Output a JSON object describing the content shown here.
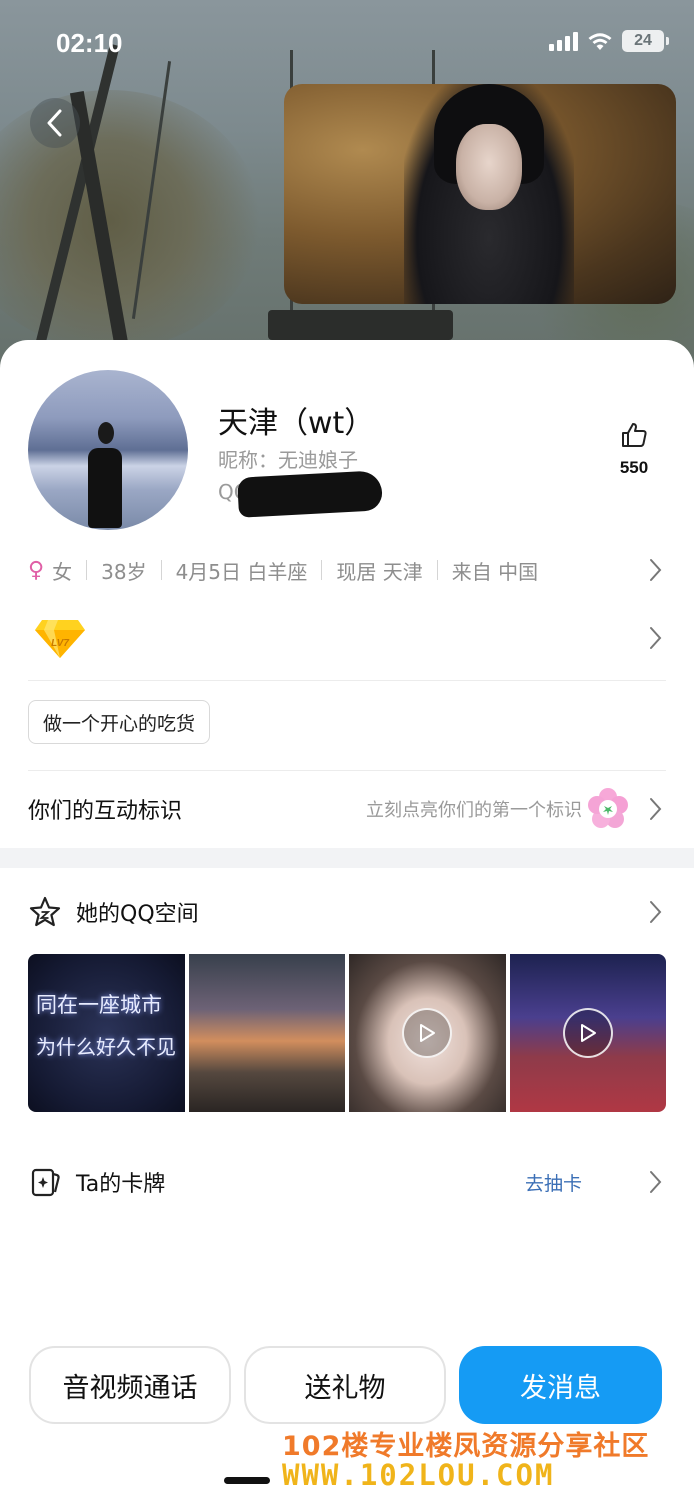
{
  "status_bar": {
    "time": "02:10",
    "battery": "24"
  },
  "profile": {
    "name": "天津（wt）",
    "nickname": "昵称：无迪娘子",
    "qq_prefix": "QQ",
    "like_count": "550"
  },
  "info": {
    "gender": "女",
    "age": "38岁",
    "birthday": "4月5日 白羊座",
    "residence": "现居 天津",
    "origin": "来自 中国"
  },
  "vip": {
    "level_badge": "LV7"
  },
  "tag": "做一个开心的吃货",
  "interaction": {
    "title": "你们的互动标识",
    "hint": "立刻点亮你们的第一个标识"
  },
  "qzone": {
    "title": "她的QQ空间",
    "thumbs": [
      {
        "caption_line1": "同在一座城市",
        "caption_line2": "为什么好久不见",
        "is_video": false
      },
      {
        "is_video": false
      },
      {
        "is_video": true
      },
      {
        "is_video": true
      }
    ]
  },
  "cards": {
    "title": "Ta的卡牌",
    "link": "去抽卡"
  },
  "actions": {
    "call": "音视频通话",
    "gift": "送礼物",
    "message": "发消息"
  },
  "watermark": {
    "line1": "102楼专业楼凤资源分享社区",
    "line2": "WWW.102LOU.COM"
  },
  "colors": {
    "primary_button": "#159bf4",
    "link": "#3b6fb6",
    "gender_female": "#e05fa6"
  }
}
